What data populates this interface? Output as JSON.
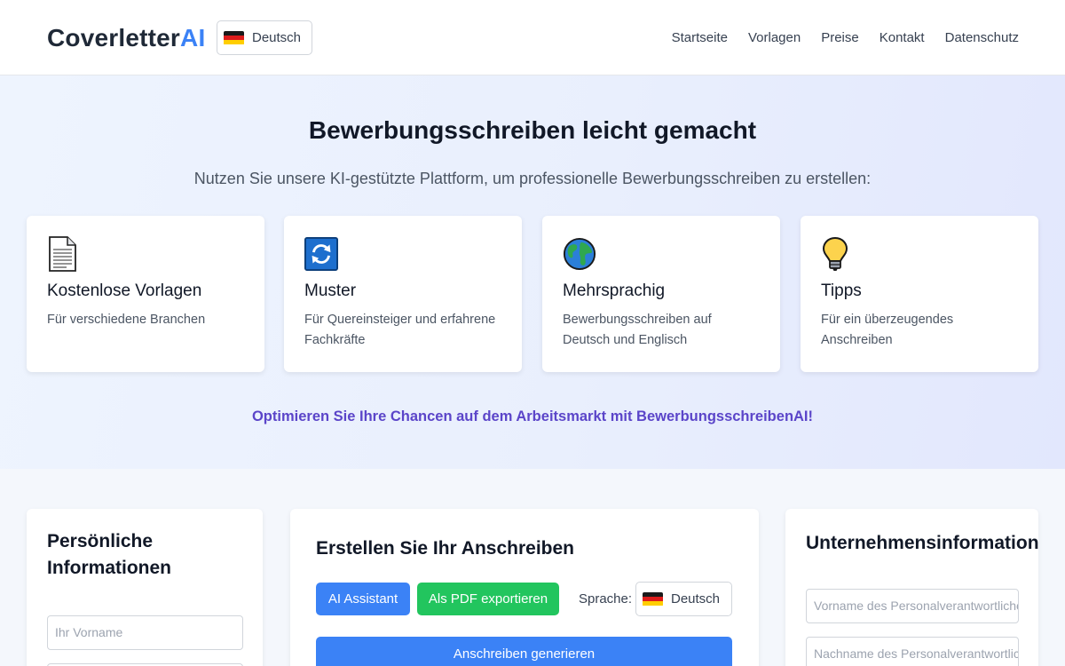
{
  "header": {
    "logo_main": "Coverletter",
    "logo_accent": "AI",
    "language": "Deutsch",
    "nav": [
      "Startseite",
      "Vorlagen",
      "Preise",
      "Kontakt",
      "Datenschutz"
    ]
  },
  "hero": {
    "title": "Bewerbungsschreiben leicht gemacht",
    "subtitle": "Nutzen Sie unsere KI-gestützte Plattform, um professionelle Bewerbungsschreiben zu erstellen:",
    "features": [
      {
        "icon": "document-icon",
        "title": "Kostenlose Vorlagen",
        "desc": "Für verschiedene Branchen"
      },
      {
        "icon": "refresh-icon",
        "title": "Muster",
        "desc": "Für Quereinsteiger und erfahrene Fachkräfte"
      },
      {
        "icon": "globe-icon",
        "title": "Mehrsprachig",
        "desc": "Bewerbungsschreiben auf Deutsch und Englisch"
      },
      {
        "icon": "lightbulb-icon",
        "title": "Tipps",
        "desc": "Für ein überzeugendes Anschreiben"
      }
    ],
    "tagline": "Optimieren Sie Ihre Chancen auf dem Arbeitsmarkt mit BewerbungsschreibenAI!"
  },
  "personal": {
    "title": "Persönliche Informationen",
    "first_name_placeholder": "Ihr Vorname"
  },
  "create": {
    "title": "Erstellen Sie Ihr Anschreiben",
    "ai_button": "AI Assistant",
    "pdf_button": "Als PDF exportieren",
    "language_label": "Sprache:",
    "language": "Deutsch",
    "generate_button": "Anschreiben generieren"
  },
  "company": {
    "title": "Unternehmensinformationen",
    "hr_first_name_placeholder": "Vorname des Personalverantwortlichen",
    "hr_last_name_placeholder": "Nachname des Personalverantwortlichen"
  },
  "colors": {
    "accent_blue": "#3b82f6",
    "accent_green": "#22c55e",
    "tagline_purple": "#5b45c9"
  }
}
